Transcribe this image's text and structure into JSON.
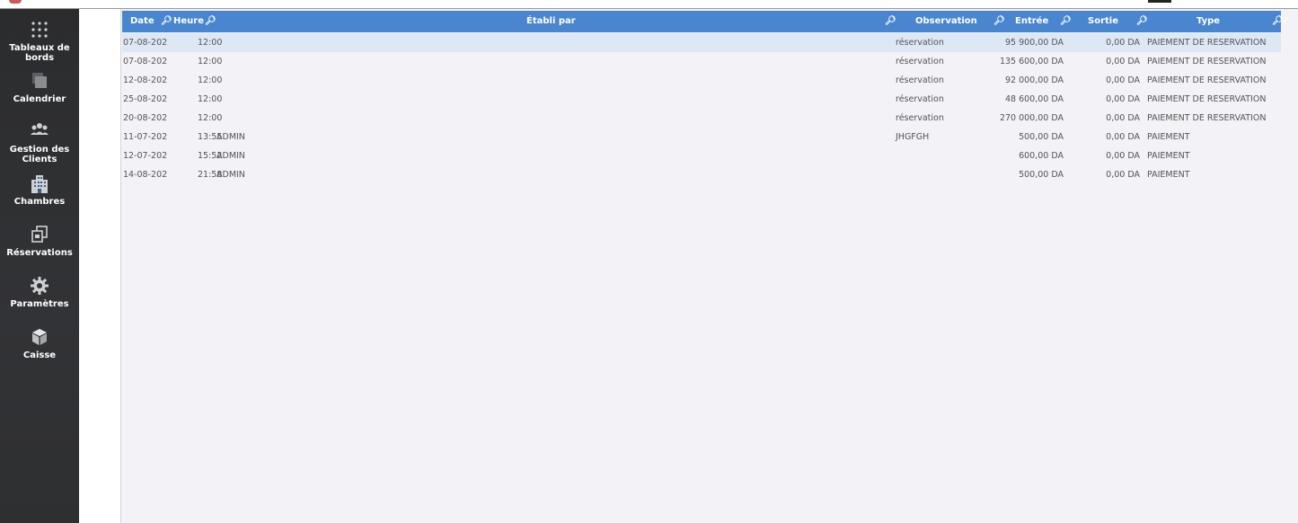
{
  "sidebar": {
    "items": [
      {
        "label": "Tableaux de bords",
        "icon": "grid-dots-icon"
      },
      {
        "label": "Calendrier",
        "icon": "calendar-icon"
      },
      {
        "label": "Gestion des Clients",
        "icon": "users-icon"
      },
      {
        "label": "Chambres",
        "icon": "building-icon"
      },
      {
        "label": "Réservations",
        "icon": "copy-documents-icon"
      },
      {
        "label": "Paramètres",
        "icon": "gear-icon"
      },
      {
        "label": "Caisse",
        "icon": "cube-icon"
      }
    ]
  },
  "table": {
    "columns": {
      "date": "Date",
      "heure": "Heure",
      "etabli": "Établi par",
      "observation": "Observation",
      "entree": "Entrée",
      "sortie": "Sortie",
      "type": "Type"
    },
    "rows": [
      {
        "date": "07-08-202",
        "heure": "12:00",
        "etabli": "",
        "observation": "réservation",
        "entree": "95 900,00 DA",
        "sortie": "0,00 DA",
        "type": "PAIEMENT DE RESERVATION"
      },
      {
        "date": "07-08-202",
        "heure": "12:00",
        "etabli": "",
        "observation": "réservation",
        "entree": "135 600,00 DA",
        "sortie": "0,00 DA",
        "type": "PAIEMENT DE RESERVATION"
      },
      {
        "date": "12-08-202",
        "heure": "12:00",
        "etabli": "",
        "observation": "réservation",
        "entree": "92 000,00 DA",
        "sortie": "0,00 DA",
        "type": "PAIEMENT DE RESERVATION"
      },
      {
        "date": "25-08-202",
        "heure": "12:00",
        "etabli": "",
        "observation": "réservation",
        "entree": "48 600,00 DA",
        "sortie": "0,00 DA",
        "type": "PAIEMENT DE RESERVATION"
      },
      {
        "date": "20-08-202",
        "heure": "12:00",
        "etabli": "",
        "observation": "réservation",
        "entree": "270 000,00 DA",
        "sortie": "0,00 DA",
        "type": "PAIEMENT DE RESERVATION"
      },
      {
        "date": "11-07-202",
        "heure": "13:55",
        "etabli": "ADMIN",
        "observation": "JHGFGH",
        "entree": "500,00 DA",
        "sortie": "0,00 DA",
        "type": "PAIEMENT"
      },
      {
        "date": "12-07-202",
        "heure": "15:52",
        "etabli": "ADMIN",
        "observation": "",
        "entree": "600,00 DA",
        "sortie": "0,00 DA",
        "type": "PAIEMENT"
      },
      {
        "date": "14-08-202",
        "heure": "21:58",
        "etabli": "ADMIN",
        "observation": "",
        "entree": "500,00 DA",
        "sortie": "0,00 DA",
        "type": "PAIEMENT"
      }
    ]
  },
  "colors": {
    "sidebar_bg": "#2e2f31",
    "header_bg": "#4a86cf",
    "selected_row_bg": "#dde8f4",
    "panel_bg": "#f2f2f7"
  }
}
